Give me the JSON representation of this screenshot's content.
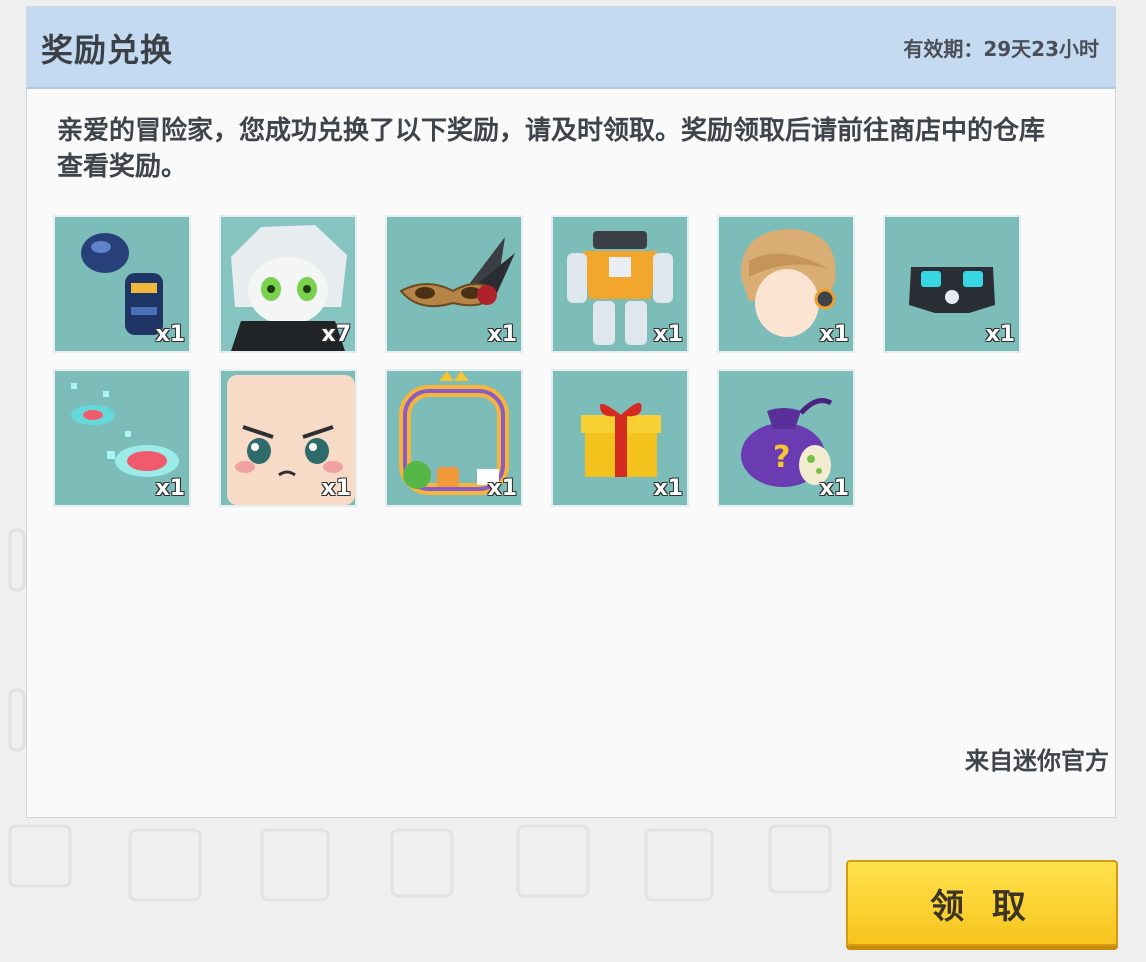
{
  "dialog": {
    "title": "奖励兑换",
    "validity": "有效期：29天23小时",
    "message": "亲爱的冒险家，您成功兑换了以下奖励，请及时领取。奖励领取后请前往商店中的仓库查看奖励。",
    "source": "来自迷你官方",
    "claim_label": "领 取"
  },
  "rewards": [
    {
      "icon": "armor-gauntlet-icon",
      "count": "x1"
    },
    {
      "icon": "character-skin-icon",
      "count": "x7"
    },
    {
      "icon": "masquerade-mask-icon",
      "count": "x1"
    },
    {
      "icon": "mech-armor-icon",
      "count": "x1"
    },
    {
      "icon": "hair-headset-icon",
      "count": "x1"
    },
    {
      "icon": "goggles-icon",
      "count": "x1"
    },
    {
      "icon": "portal-effect-icon",
      "count": "x1"
    },
    {
      "icon": "face-icon",
      "count": "x1"
    },
    {
      "icon": "avatar-frame-icon",
      "count": "x1"
    },
    {
      "icon": "gift-box-icon",
      "count": "x1"
    },
    {
      "icon": "mystery-bag-icon",
      "count": "x1"
    }
  ],
  "colors": {
    "header": "#c3daf0",
    "tile": "#7cbcb9",
    "button": "#f6c41d"
  }
}
